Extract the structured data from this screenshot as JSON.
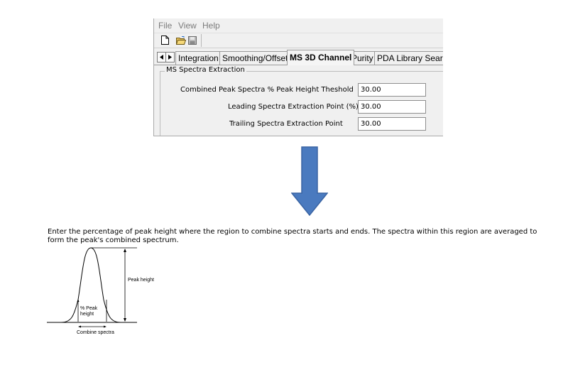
{
  "menu": {
    "file": "File",
    "view": "View",
    "help": "Help"
  },
  "toolbar": {
    "new_icon": "new-document-icon",
    "open_icon": "open-folder-icon",
    "save_icon": "save-disk-icon"
  },
  "tabs": [
    {
      "label": "Integration",
      "active": false
    },
    {
      "label": "Smoothing/Offset",
      "active": false
    },
    {
      "label": "MS 3D Channel",
      "active": true
    },
    {
      "label": "Purity",
      "active": false
    },
    {
      "label": "PDA Library Searcl",
      "active": false
    }
  ],
  "group": {
    "legend": "MS Spectra Extraction",
    "fields": [
      {
        "label": "Combined Peak Spectra % Peak Height Theshold",
        "value": "30.00"
      },
      {
        "label": "Leading Spectra Extraction Point (%)",
        "value": "30.00"
      },
      {
        "label": "Trailing Spectra Extraction Point",
        "value": "30.00"
      }
    ]
  },
  "arrow": {
    "color": "#4a7abf",
    "icon": "down-arrow-icon"
  },
  "help": {
    "text": "Enter the percentage of peak height where the region to combine spectra starts and ends. The spectra within this region are averaged to form the peak's combined spectrum."
  },
  "diagram": {
    "peak_height_label": "Peak height",
    "pct_label_line1": "% Peak",
    "pct_label_line2": "height",
    "combine_label": "Combine spectra"
  }
}
